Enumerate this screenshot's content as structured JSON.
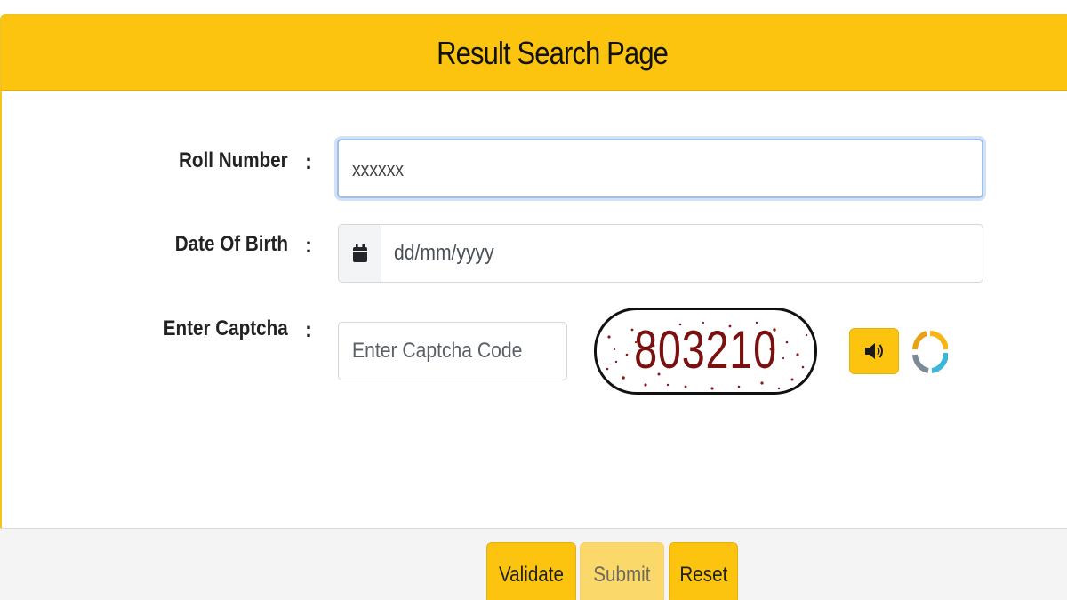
{
  "header": {
    "title": "Result Search Page"
  },
  "form": {
    "roll_number": {
      "label": "Roll Number",
      "value": "xxxxxx"
    },
    "date_of_birth": {
      "label": "Date Of Birth",
      "placeholder": "dd/mm/yyyy",
      "icon": "calendar-icon"
    },
    "captcha": {
      "label": "Enter Captcha",
      "placeholder": "Enter Captcha Code",
      "code": "803210",
      "audio_icon": "speaker-icon",
      "refresh_icon": "refresh-icon"
    },
    "colon": ":"
  },
  "buttons": {
    "validate": "Validate",
    "submit": "Submit",
    "reset": "Reset"
  },
  "colors": {
    "accent": "#fcc40e",
    "captcha_text": "#7a1010"
  }
}
